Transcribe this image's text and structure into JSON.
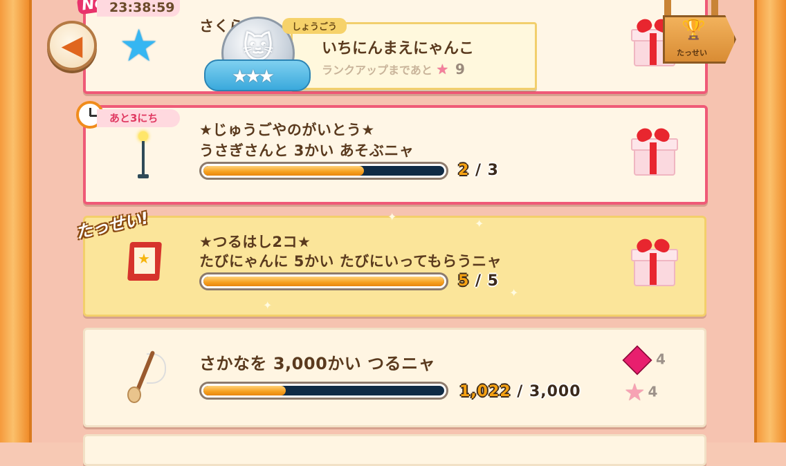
{
  "header": {
    "new_badge": "New",
    "timer": "23:38:59",
    "title_tag": "しょうごう",
    "rank_name": "いちにんまえにゃんこ",
    "rank_up_text": "ランクアップまであと",
    "rank_up_count": "9",
    "achievements_label": "たっせい"
  },
  "missions": [
    {
      "title": "さくら",
      "title_line2": "",
      "progress": null,
      "count_current": "",
      "count_total": ""
    },
    {
      "days_left": "あと3にち",
      "title": "★じゅうごやのがいとう★",
      "title_line2": "うさぎさんと 3かい あそぶニャ",
      "progress": 0.6667,
      "count_current": "2",
      "count_total": "3"
    },
    {
      "done_badge": "たっせい!",
      "title": "★つるはし2コ★",
      "title_line2": "たびにゃんに 5かい たびにいってもらうニャ",
      "progress": 1.0,
      "count_current": "5",
      "count_total": "5"
    },
    {
      "title": "さかなを 3,000かい つるニャ",
      "progress": 0.3407,
      "count_current": "1,022",
      "count_total": "3,000",
      "reward_gem_count": "4",
      "reward_star_count": "4"
    }
  ],
  "colors": {
    "accent_pink": "#ef5a77",
    "bar_fill": "#f6a01f",
    "bar_empty": "#0f2b45",
    "done_card": "#fbe59a"
  },
  "icons": [
    "back-arrow-icon",
    "blue-star-icon",
    "clock-icon",
    "lamp-icon",
    "signboard-icon",
    "fishing-rod-icon",
    "gift-icon",
    "trophy-icon",
    "gem-icon",
    "pink-star-icon"
  ]
}
